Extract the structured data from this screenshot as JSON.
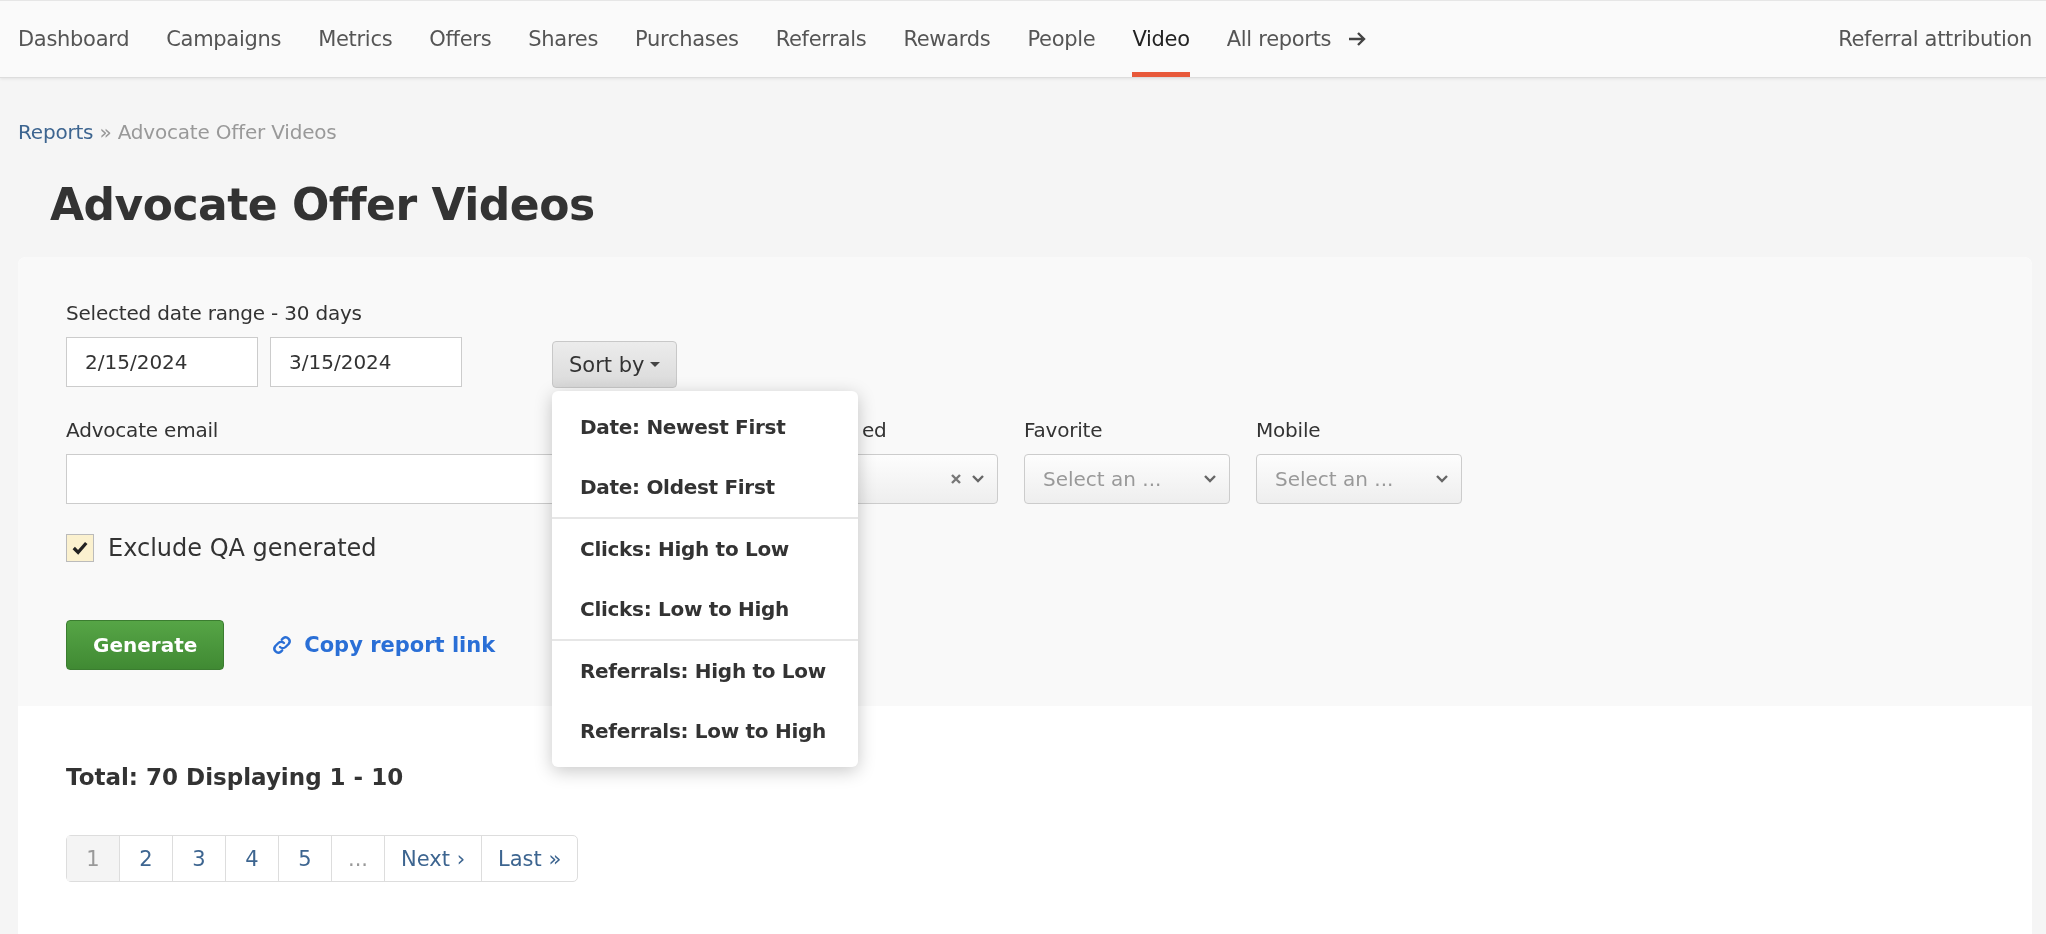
{
  "nav": {
    "items": [
      {
        "label": "Dashboard",
        "selected": false
      },
      {
        "label": "Campaigns",
        "selected": false
      },
      {
        "label": "Metrics",
        "selected": false
      },
      {
        "label": "Offers",
        "selected": false
      },
      {
        "label": "Shares",
        "selected": false
      },
      {
        "label": "Purchases",
        "selected": false
      },
      {
        "label": "Referrals",
        "selected": false
      },
      {
        "label": "Rewards",
        "selected": false
      },
      {
        "label": "People",
        "selected": false
      },
      {
        "label": "Video",
        "selected": true
      }
    ],
    "all_reports": "All reports",
    "right_link": "Referral attribution"
  },
  "breadcrumb": {
    "link": "Reports",
    "separator": "»",
    "current": "Advocate Offer Videos"
  },
  "title": "Advocate Offer Videos",
  "filters": {
    "date_range_label": "Selected date range - 30 days",
    "start_date": "2/15/2024",
    "end_date": "3/15/2024",
    "sort_button": "Sort by",
    "sort_menu": [
      {
        "label": "Date: Newest First",
        "divider_before": false
      },
      {
        "label": "Date: Oldest First",
        "divider_before": false
      },
      {
        "label": "Clicks: High to Low",
        "divider_before": true
      },
      {
        "label": "Clicks: Low to High",
        "divider_before": false
      },
      {
        "label": "Referrals: High to Low",
        "divider_before": true
      },
      {
        "label": "Referrals: Low to High",
        "divider_before": false
      }
    ],
    "email_label": "Advocate email",
    "third_label": "ed",
    "selects": [
      {
        "label": "Favorite",
        "placeholder": "Select an ..."
      },
      {
        "label": "Mobile",
        "placeholder": "Select an ..."
      }
    ],
    "exclude_qa": {
      "label": "Exclude QA generated",
      "checked": true
    },
    "generate_button": "Generate",
    "copy_link": "Copy report link"
  },
  "results": {
    "summary": "Total: 70 Displaying 1 - 10",
    "pagination": [
      {
        "label": "1",
        "kind": "page",
        "selected": true
      },
      {
        "label": "2",
        "kind": "page",
        "selected": false
      },
      {
        "label": "3",
        "kind": "page",
        "selected": false
      },
      {
        "label": "4",
        "kind": "page",
        "selected": false
      },
      {
        "label": "5",
        "kind": "page",
        "selected": false
      },
      {
        "label": "...",
        "kind": "gap"
      },
      {
        "label": "Next ›",
        "kind": "page",
        "selected": false
      },
      {
        "label": "Last »",
        "kind": "page",
        "selected": false
      }
    ]
  }
}
